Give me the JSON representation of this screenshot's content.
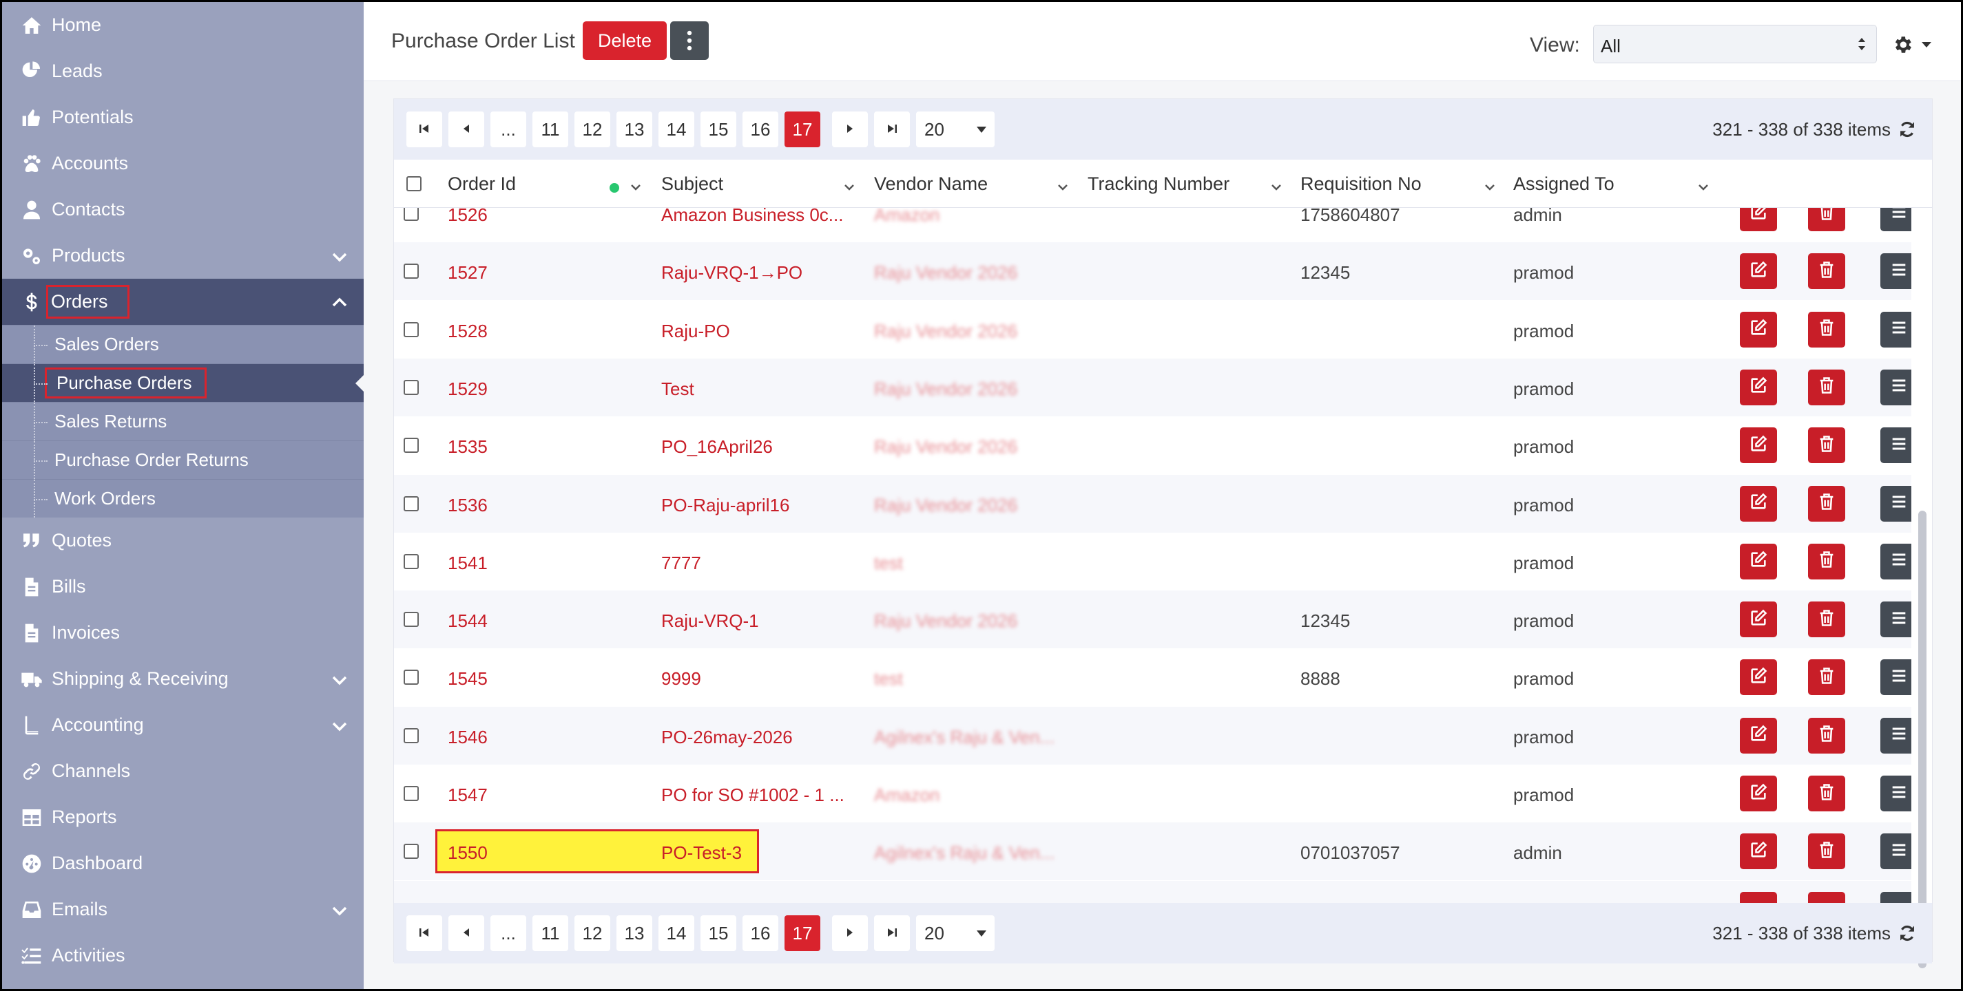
{
  "sidebar": {
    "items": [
      {
        "label": "Home",
        "icon": "home-icon",
        "chevron": null
      },
      {
        "label": "Leads",
        "icon": "leads-icon",
        "chevron": null
      },
      {
        "label": "Potentials",
        "icon": "thumbs-up-icon",
        "chevron": null
      },
      {
        "label": "Accounts",
        "icon": "paw-icon",
        "chevron": null
      },
      {
        "label": "Contacts",
        "icon": "user-icon",
        "chevron": null
      },
      {
        "label": "Products",
        "icon": "gears-icon",
        "chevron": "down"
      },
      {
        "label": "Orders",
        "icon": "dollar-icon",
        "chevron": "up"
      }
    ],
    "orders_sub": [
      {
        "label": "Sales Orders"
      },
      {
        "label": "Purchase Orders"
      },
      {
        "label": "Sales Returns"
      },
      {
        "label": "Purchase Order Returns"
      },
      {
        "label": "Work Orders"
      }
    ],
    "items_after": [
      {
        "label": "Quotes",
        "icon": "quote-icon",
        "chevron": null
      },
      {
        "label": "Bills",
        "icon": "file-icon",
        "chevron": null
      },
      {
        "label": "Invoices",
        "icon": "file-icon",
        "chevron": null
      },
      {
        "label": "Shipping & Receiving",
        "icon": "truck-icon",
        "chevron": "down"
      },
      {
        "label": "Accounting",
        "icon": "book-icon",
        "chevron": "down"
      },
      {
        "label": "Channels",
        "icon": "link-icon",
        "chevron": null
      },
      {
        "label": "Reports",
        "icon": "table-icon",
        "chevron": null
      },
      {
        "label": "Dashboard",
        "icon": "gauge-icon",
        "chevron": null
      },
      {
        "label": "Emails",
        "icon": "inbox-icon",
        "chevron": "down"
      },
      {
        "label": "Activities",
        "icon": "tasks-icon",
        "chevron": null
      }
    ]
  },
  "header": {
    "title": "Purchase Order List",
    "delete_label": "Delete",
    "view_label": "View:",
    "view_value": "All"
  },
  "pager": {
    "ellipsis": "...",
    "pages": [
      "11",
      "12",
      "13",
      "14",
      "15",
      "16",
      "17"
    ],
    "active_page": "17",
    "page_size": "20",
    "items_text": "321 - 338 of 338 items"
  },
  "columns": [
    "Order Id",
    "Subject",
    "Vendor Name",
    "Tracking Number",
    "Requisition No",
    "Assigned To"
  ],
  "rows": [
    {
      "id": "1526",
      "subject": "Amazon Business 0c...",
      "vendor": "Amazon",
      "tracking": "",
      "requisition": "1758604807",
      "assigned": "admin"
    },
    {
      "id": "1527",
      "subject": "Raju-VRQ-1→PO",
      "vendor": "Raju Vendor 2026",
      "tracking": "",
      "requisition": "12345",
      "assigned": "pramod"
    },
    {
      "id": "1528",
      "subject": "Raju-PO",
      "vendor": "Raju Vendor 2026",
      "tracking": "",
      "requisition": "",
      "assigned": "pramod"
    },
    {
      "id": "1529",
      "subject": "Test",
      "vendor": "Raju Vendor 2026",
      "tracking": "",
      "requisition": "",
      "assigned": "pramod"
    },
    {
      "id": "1535",
      "subject": "PO_16April26",
      "vendor": "Raju Vendor 2026",
      "tracking": "",
      "requisition": "",
      "assigned": "pramod"
    },
    {
      "id": "1536",
      "subject": "PO-Raju-april16",
      "vendor": "Raju Vendor 2026",
      "tracking": "",
      "requisition": "",
      "assigned": "pramod"
    },
    {
      "id": "1541",
      "subject": "7777",
      "vendor": "test",
      "tracking": "",
      "requisition": "",
      "assigned": "pramod"
    },
    {
      "id": "1544",
      "subject": "Raju-VRQ-1",
      "vendor": "Raju Vendor 2026",
      "tracking": "",
      "requisition": "12345",
      "assigned": "pramod"
    },
    {
      "id": "1545",
      "subject": "9999",
      "vendor": "test",
      "tracking": "",
      "requisition": "8888",
      "assigned": "pramod"
    },
    {
      "id": "1546",
      "subject": "PO-26may-2026",
      "vendor": "Agilnex's Raju & Ven...",
      "tracking": "",
      "requisition": "",
      "assigned": "pramod"
    },
    {
      "id": "1547",
      "subject": "PO for SO #1002 - 1 ...",
      "vendor": "Amazon",
      "tracking": "",
      "requisition": "",
      "assigned": "pramod"
    },
    {
      "id": "1550",
      "subject": "PO-Test-3",
      "vendor": "Agilnex's Raju & Ven...",
      "tracking": "",
      "requisition": "0701037057",
      "assigned": "admin"
    }
  ],
  "colors": {
    "accent": "#d9232d",
    "sidebar": "#9aa1bd",
    "sidebar_active": "#4a5275",
    "highlight": "#fff23b"
  }
}
